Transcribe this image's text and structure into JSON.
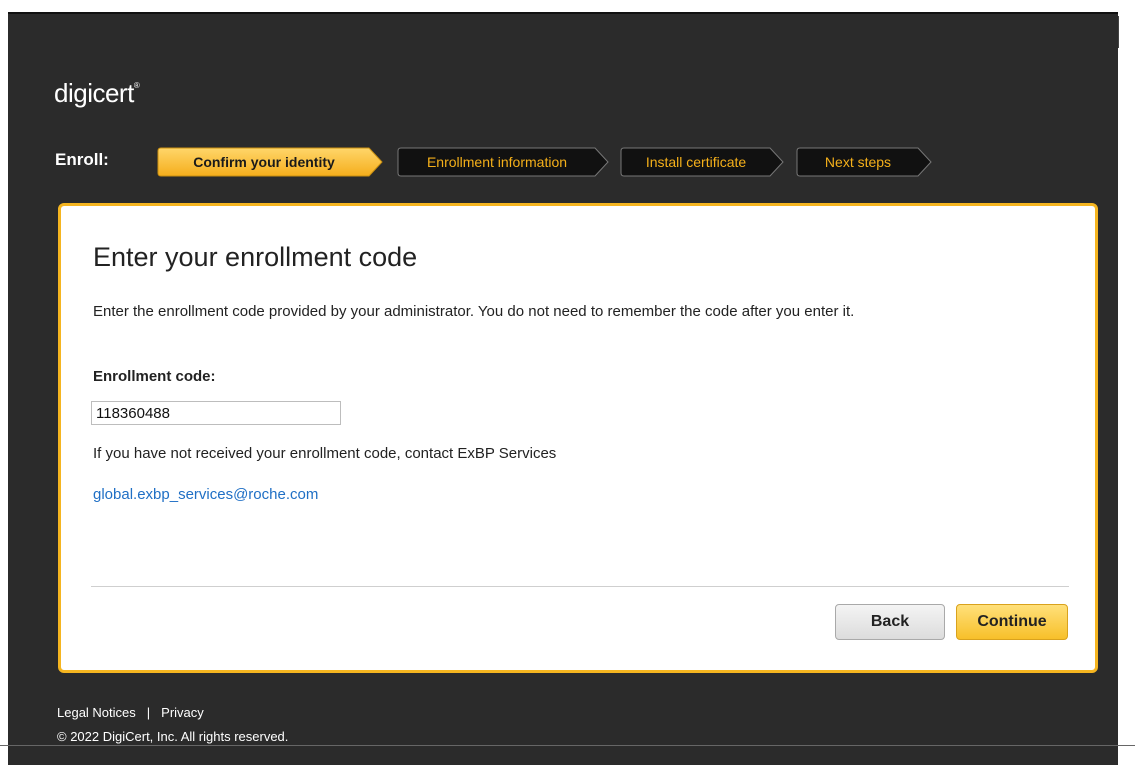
{
  "brand": {
    "logo_text": "digicert",
    "logo_mark": "®"
  },
  "steps_label": "Enroll:",
  "steps": [
    {
      "label": "Confirm your identity",
      "active": true
    },
    {
      "label": "Enrollment information",
      "active": false
    },
    {
      "label": "Install certificate",
      "active": false
    },
    {
      "label": "Next steps",
      "active": false
    }
  ],
  "card": {
    "heading": "Enter your enrollment code",
    "description": "Enter the enrollment code provided by your administrator. You do not need to remember the code after you enter it.",
    "field_label": "Enrollment code:",
    "field_value": "118360488",
    "help_text": "If you have not received your enrollment code, contact ExBP Services",
    "contact_email": "global.exbp_services@roche.com",
    "back_label": "Back",
    "continue_label": "Continue"
  },
  "footer": {
    "legal_label": "Legal Notices",
    "separator": "|",
    "privacy_label": "Privacy",
    "copyright": "© 2022 DigiCert, Inc. All rights reserved."
  },
  "colors": {
    "accent": "#f5b520",
    "background": "#2b2b2b",
    "link": "#1f6fc5"
  }
}
